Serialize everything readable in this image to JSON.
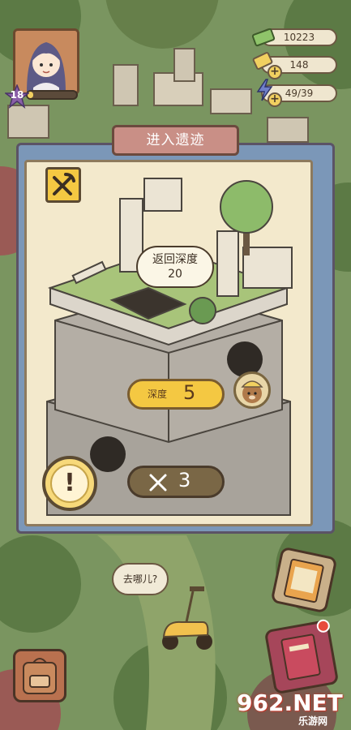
{
  "player": {
    "level": "18",
    "xp_progress": 0.12
  },
  "resources": [
    {
      "name": "cash",
      "value": "10223",
      "icon": "cash-icon"
    },
    {
      "name": "coins",
      "value": "148",
      "icon": "coin-plus-icon"
    },
    {
      "name": "energy",
      "value": "49/39",
      "icon": "lightning-plus-icon"
    }
  ],
  "modal": {
    "title": "进入遗迹",
    "speech_bubble": {
      "line1": "返回深度",
      "line2": "20"
    },
    "depth": {
      "label": "深度",
      "value": "5"
    },
    "pickaxe_count": "3"
  },
  "world": {
    "npc_bubble": "去哪儿?"
  },
  "watermark": {
    "main": "962.NET",
    "sub": "乐游网"
  },
  "colors": {
    "panel_cream": "#f3e9cc",
    "panel_blue": "#7b97b8",
    "title_tab": "#c98f86",
    "accent_yellow": "#f4c842",
    "grass": "#6f8a55"
  }
}
